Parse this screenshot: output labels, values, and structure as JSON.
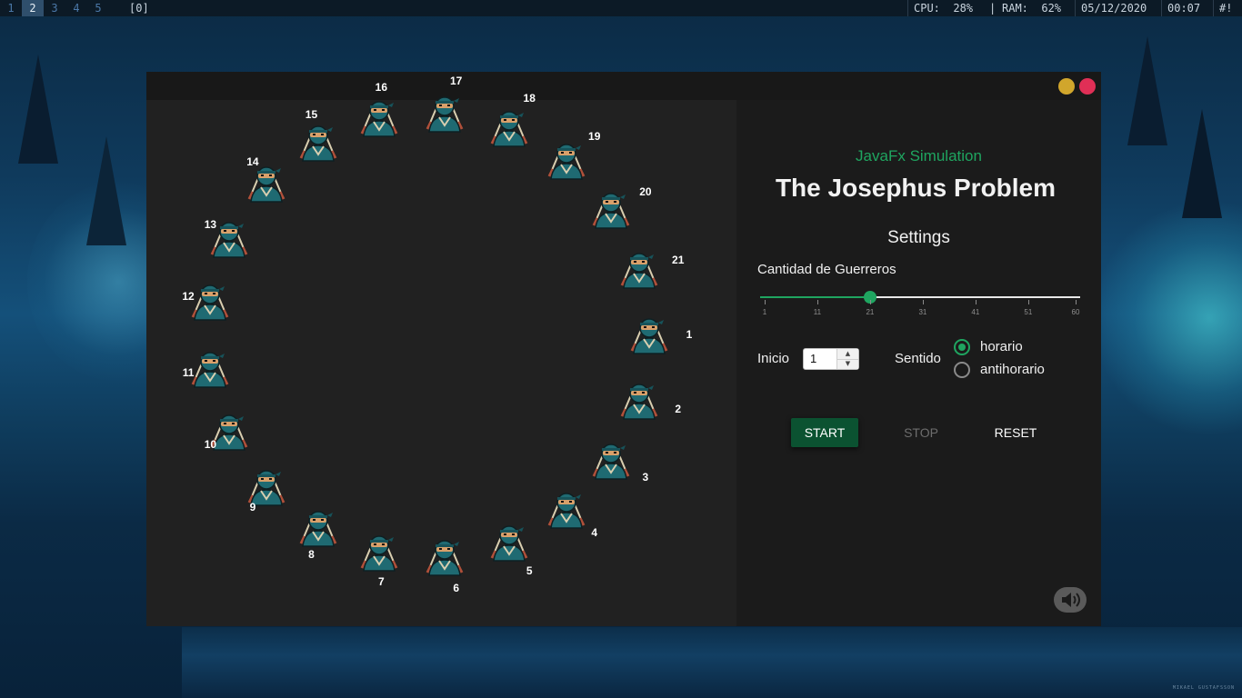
{
  "topbar": {
    "workspaces": [
      "1",
      "2",
      "3",
      "4",
      "5"
    ],
    "active_workspace": "2",
    "layout_indicator": "[0]",
    "cpu": "CPU:  28%",
    "separator": "|",
    "ram": "RAM:  62%",
    "date": "05/12/2020",
    "time": "00:07",
    "shebang": "#!"
  },
  "window": {
    "controls": {
      "minimize_color": "#d1a62c",
      "close_color": "#e02f56"
    }
  },
  "simulation": {
    "warrior_icon": "ninja-icon",
    "warriors": [
      "1",
      "2",
      "3",
      "4",
      "5",
      "6",
      "7",
      "8",
      "9",
      "10",
      "11",
      "12",
      "13",
      "14",
      "15",
      "16",
      "17",
      "18",
      "19",
      "20",
      "21"
    ]
  },
  "panel": {
    "subtitle": "JavaFx Simulation",
    "title": "The Josephus Problem",
    "settings_heading": "Settings",
    "slider_label": "Cantidad de Guerreros",
    "slider": {
      "value": 21,
      "min": 1,
      "max": 60,
      "ticks": [
        "1",
        "11",
        "21",
        "31",
        "41",
        "51",
        "60"
      ]
    },
    "inicio_label": "Inicio",
    "inicio_value": "1",
    "sentido_label": "Sentido",
    "radio_options": [
      "horario",
      "antihorario"
    ],
    "radio_selected": "horario",
    "start_label": "START",
    "stop_label": "STOP",
    "reset_label": "RESET",
    "sound_icon": "speaker-icon"
  },
  "wallpaper": {
    "credit": "MIKAEL GUSTAFSSON"
  },
  "colors": {
    "accent": "#1fa560",
    "start_button": "#0b5231",
    "window_bg": "#1e1e1e"
  }
}
